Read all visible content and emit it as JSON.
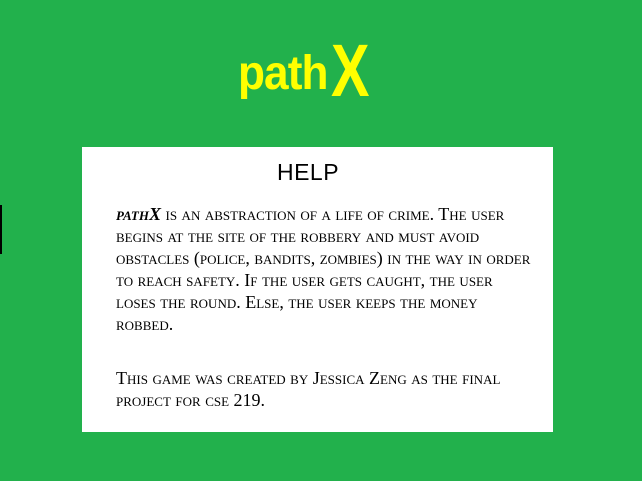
{
  "logo": {
    "part1": "path",
    "part2": "X",
    "color": "#ffff00"
  },
  "background_color": "#22b14c",
  "help": {
    "title": "HELP",
    "game_name": "pathX",
    "paragraph1_rest": " is an abstraction of a life of crime. The user begins at the site of the robbery and must avoid obstacles (police, bandits, zombies) in the way in order to reach safety. If the user gets caught, the user loses the round. Else, the user keeps the money robbed.",
    "paragraph2": "This game was created by Jessica Zeng as the final project for cse 219."
  }
}
